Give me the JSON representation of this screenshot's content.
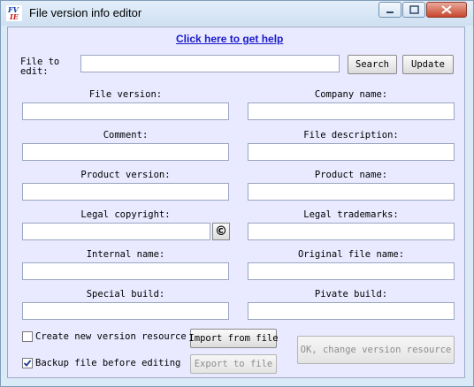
{
  "window": {
    "title": "File version info editor",
    "icon_text": "FV\nIE"
  },
  "header": {
    "help_link": "Click here to get help"
  },
  "file_to_edit": {
    "label": "File to edit:",
    "value": "",
    "search_label": "Search",
    "update_label": "Update"
  },
  "fields": {
    "file_version": {
      "label": "File version:",
      "value": ""
    },
    "company_name": {
      "label": "Company name:",
      "value": ""
    },
    "comment": {
      "label": "Comment:",
      "value": ""
    },
    "file_description": {
      "label": "File description:",
      "value": ""
    },
    "product_version": {
      "label": "Product version:",
      "value": ""
    },
    "product_name": {
      "label": "Product name:",
      "value": ""
    },
    "legal_copyright": {
      "label": "Legal copyright:",
      "value": ""
    },
    "legal_trademarks": {
      "label": "Legal trademarks:",
      "value": ""
    },
    "internal_name": {
      "label": "Internal name:",
      "value": ""
    },
    "original_file_name": {
      "label": "Original file name:",
      "value": ""
    },
    "special_build": {
      "label": "Special build:",
      "value": ""
    },
    "private_build": {
      "label": "Pivate build:",
      "value": ""
    }
  },
  "copyright_button": "©",
  "options": {
    "create_new": {
      "label": "Create new version resource",
      "checked": false
    },
    "backup": {
      "label": "Backup file before editing",
      "checked": true
    }
  },
  "buttons": {
    "import": "Import from file",
    "export": "Export to file",
    "ok": "OK, change version resource"
  }
}
